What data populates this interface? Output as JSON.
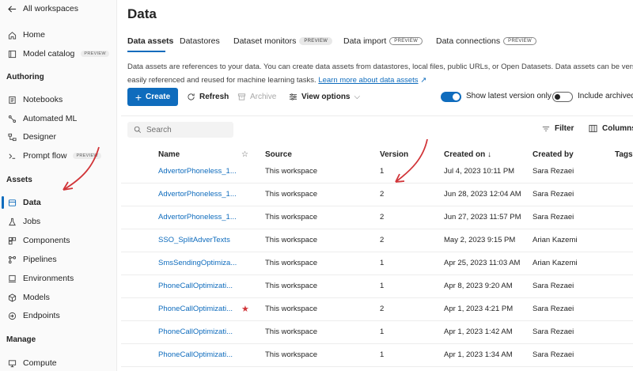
{
  "sidebar": {
    "back": "All workspaces",
    "home": "Home",
    "model_catalog": "Model catalog",
    "model_catalog_badge": "PREVIEW",
    "authoring_header": "Authoring",
    "notebooks": "Notebooks",
    "automated_ml": "Automated ML",
    "designer": "Designer",
    "prompt_flow": "Prompt flow",
    "prompt_flow_badge": "PREVIEW",
    "assets_header": "Assets",
    "data": "Data",
    "jobs": "Jobs",
    "components": "Components",
    "pipelines": "Pipelines",
    "environments": "Environments",
    "models": "Models",
    "endpoints": "Endpoints",
    "manage_header": "Manage",
    "compute": "Compute"
  },
  "page": {
    "title": "Data",
    "tabs": [
      "Data assets",
      "Datastores",
      "Dataset monitors",
      "Data import",
      "Data connections"
    ],
    "tab_badges": {
      "dataset_monitors": "PREVIEW",
      "data_import": "PREVIEW",
      "data_connections": "PREVIEW"
    },
    "description_line1": "Data assets are references to your data. You can create data assets from datastores, local files, public URLs, or Open Datasets. Data assets can be versioned ar",
    "description_line2": "easily referenced and reused for machine learning tasks.",
    "learn_more": "Learn more about data assets"
  },
  "toolbar": {
    "create": "Create",
    "refresh": "Refresh",
    "archive": "Archive",
    "view_options": "View options",
    "show_latest": "Show latest version only",
    "show_latest_on": true,
    "include_archived": "Include archived",
    "include_archived_on": false
  },
  "list": {
    "search_placeholder": "Search",
    "filter": "Filter",
    "columns_btn": "Columns",
    "headers": {
      "name": "Name",
      "source": "Source",
      "version": "Version",
      "created_on": "Created on ↓",
      "created_by": "Created by",
      "tags": "Tags"
    },
    "rows": [
      {
        "name": "AdvertorPhoneless_1...",
        "starred": false,
        "source": "This workspace",
        "version": "1",
        "created_on": "Jul 4, 2023 10:11 PM",
        "created_by": "Sara Rezaei"
      },
      {
        "name": "AdvertorPhoneless_1...",
        "starred": false,
        "source": "This workspace",
        "version": "2",
        "created_on": "Jun 28, 2023 12:04 AM",
        "created_by": "Sara Rezaei"
      },
      {
        "name": "AdvertorPhoneless_1...",
        "starred": false,
        "source": "This workspace",
        "version": "2",
        "created_on": "Jun 27, 2023 11:57 PM",
        "created_by": "Sara Rezaei"
      },
      {
        "name": "SSO_SplitAdverTexts",
        "starred": false,
        "source": "This workspace",
        "version": "2",
        "created_on": "May 2, 2023 9:15 PM",
        "created_by": "Arian Kazemi"
      },
      {
        "name": "SmsSendingOptimiza...",
        "starred": false,
        "source": "This workspace",
        "version": "1",
        "created_on": "Apr 25, 2023 11:03 AM",
        "created_by": "Arian Kazemi"
      },
      {
        "name": "PhoneCallOptimizati...",
        "starred": false,
        "source": "This workspace",
        "version": "1",
        "created_on": "Apr 8, 2023 9:20 AM",
        "created_by": "Sara Rezaei"
      },
      {
        "name": "PhoneCallOptimizati...",
        "starred": true,
        "source": "This workspace",
        "version": "2",
        "created_on": "Apr 1, 2023 4:21 PM",
        "created_by": "Sara Rezaei"
      },
      {
        "name": "PhoneCallOptimizati...",
        "starred": false,
        "source": "This workspace",
        "version": "1",
        "created_on": "Apr 1, 2023 1:42 AM",
        "created_by": "Sara Rezaei"
      },
      {
        "name": "PhoneCallOptimizati...",
        "starred": false,
        "source": "This workspace",
        "version": "1",
        "created_on": "Apr 1, 2023 1:34 AM",
        "created_by": "Sara Rezaei"
      }
    ]
  },
  "colors": {
    "accent": "#0f6cbd",
    "annotation": "#d13438"
  }
}
